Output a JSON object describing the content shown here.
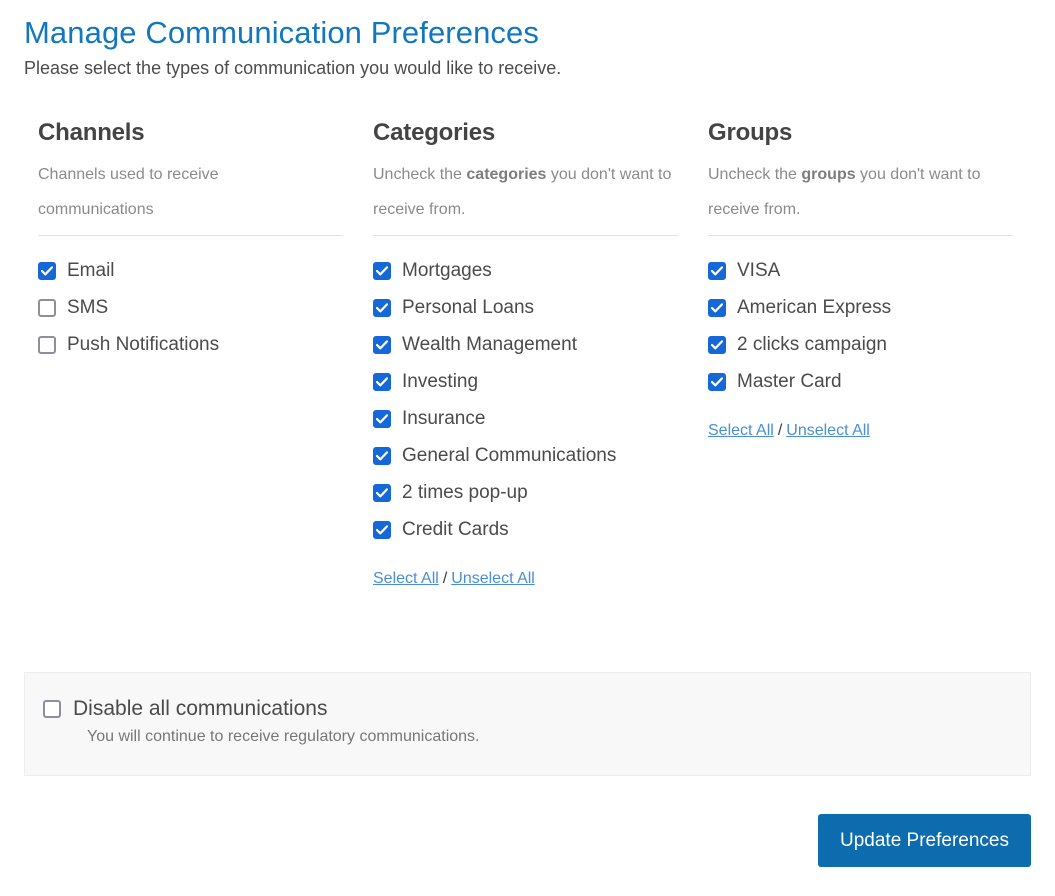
{
  "header": {
    "title": "Manage Communication Preferences",
    "subtitle": "Please select the types of communication you would like to receive.",
    "title_color": "#1278be"
  },
  "columns": [
    {
      "title": "Channels",
      "description_prefix": "Channels used to receive communications",
      "description_bold": "",
      "description_suffix": "",
      "items": [
        {
          "label": "Email",
          "checked": true
        },
        {
          "label": "SMS",
          "checked": false
        },
        {
          "label": "Push Notifications",
          "checked": false
        }
      ],
      "has_select_links": false,
      "select_all_label": "",
      "unselect_all_label": "",
      "separator": ""
    },
    {
      "title": "Categories",
      "description_prefix": "Uncheck the ",
      "description_bold": "categories",
      "description_suffix": " you don't want to receive from.",
      "items": [
        {
          "label": "Mortgages",
          "checked": true
        },
        {
          "label": "Personal Loans",
          "checked": true
        },
        {
          "label": "Wealth Management",
          "checked": true
        },
        {
          "label": "Investing",
          "checked": true
        },
        {
          "label": "Insurance",
          "checked": true
        },
        {
          "label": "General Communications",
          "checked": true
        },
        {
          "label": "2 times pop-up",
          "checked": true
        },
        {
          "label": "Credit Cards",
          "checked": true
        }
      ],
      "has_select_links": true,
      "select_all_label": "Select All",
      "unselect_all_label": "Unselect All",
      "separator": "/"
    },
    {
      "title": "Groups",
      "description_prefix": "Uncheck the ",
      "description_bold": "groups",
      "description_suffix": " you don't want to receive from.",
      "items": [
        {
          "label": "VISA",
          "checked": true
        },
        {
          "label": "American Express",
          "checked": true
        },
        {
          "label": "2 clicks campaign",
          "checked": true
        },
        {
          "label": "Master Card",
          "checked": true
        }
      ],
      "has_select_links": true,
      "select_all_label": "Select All",
      "unselect_all_label": "Unselect All",
      "separator": "/"
    }
  ],
  "disable_panel": {
    "label": "Disable all communications",
    "checked": false,
    "note": "You will continue to receive regulatory communications."
  },
  "submit": {
    "label": "Update Preferences",
    "color": "#0d6cad"
  },
  "colors": {
    "checkbox_checked": "#1668d8",
    "checkbox_border": "#8e8e9e",
    "link": "#4a8fd4",
    "heading": "#444444",
    "muted": "#8b8b8b"
  }
}
